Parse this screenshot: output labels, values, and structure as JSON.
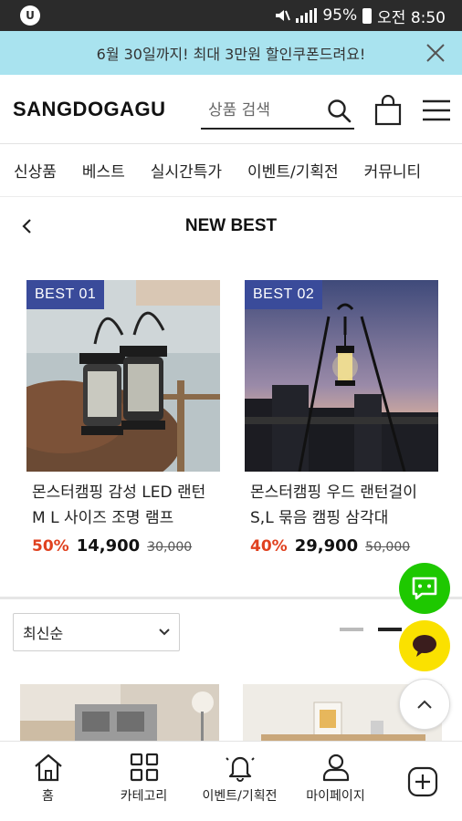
{
  "status_bar": {
    "app_icon_text": "U",
    "battery": "95%",
    "time": "오전 8:50"
  },
  "promo_banner": {
    "text": "6월 30일까지! 최대 3만원 할인쿠폰드려요!",
    "close_icon": "close-icon"
  },
  "header": {
    "logo": "SANGDOGAGU",
    "search_placeholder": "상품 검색"
  },
  "category_nav": [
    "신상품",
    "베스트",
    "실시간특가",
    "이벤트/기획전",
    "커뮤니티"
  ],
  "page_title": "NEW BEST",
  "products": [
    {
      "badge": "BEST 01",
      "name": "몬스터캠핑 감성 LED 랜턴 M L 사이즈 조명 램프",
      "discount": "50%",
      "price": "14,900",
      "original_price": "30,000"
    },
    {
      "badge": "BEST 02",
      "name": "몬스터캠핑 우드 랜턴걸이 S,L 묶음 캠핑 삼각대",
      "discount": "40%",
      "price": "29,900",
      "original_price": "50,000"
    }
  ],
  "sort": {
    "selected": "최신순"
  },
  "bottom_nav": [
    {
      "label": "홈",
      "icon": "home-icon"
    },
    {
      "label": "카테고리",
      "icon": "grid-icon"
    },
    {
      "label": "이벤트/기획전",
      "icon": "bell-icon"
    },
    {
      "label": "마이페이지",
      "icon": "user-icon"
    }
  ],
  "colors": {
    "banner_bg": "#a9e3ef",
    "badge_bg": "#3a4b9a",
    "discount": "#e0411f",
    "chat_green": "#1ec800",
    "kakao_yellow": "#fae100"
  }
}
